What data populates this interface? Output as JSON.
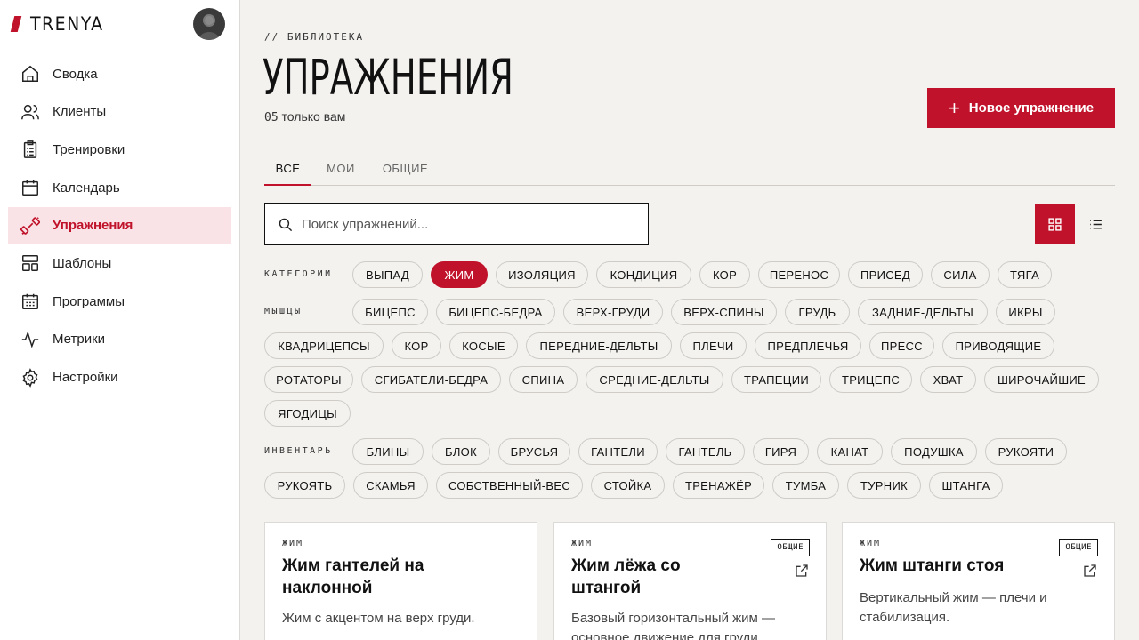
{
  "brand": {
    "name": "TRENYA"
  },
  "sidebar": {
    "items": [
      {
        "label": "Сводка",
        "icon": "home-icon"
      },
      {
        "label": "Клиенты",
        "icon": "users-icon"
      },
      {
        "label": "Тренировки",
        "icon": "clipboard-icon"
      },
      {
        "label": "Календарь",
        "icon": "calendar-icon"
      },
      {
        "label": "Упражнения",
        "icon": "dumbbell-icon",
        "active": true
      },
      {
        "label": "Шаблоны",
        "icon": "layout-icon"
      },
      {
        "label": "Программы",
        "icon": "calendar-grid-icon"
      },
      {
        "label": "Метрики",
        "icon": "activity-icon"
      },
      {
        "label": "Настройки",
        "icon": "gear-icon"
      }
    ]
  },
  "header": {
    "breadcrumb": "// БИБЛИОТЕКА",
    "title": "УПРАЖНЕНИЯ",
    "count": "05",
    "count_suffix": "только вам",
    "new_button": "Новое упражнение"
  },
  "tabs": [
    {
      "label": "ВСЕ",
      "active": true
    },
    {
      "label": "МОИ"
    },
    {
      "label": "ОБЩИЕ"
    }
  ],
  "search": {
    "placeholder": "Поиск упражнений..."
  },
  "filters": {
    "categories_label": "КАТЕГОРИИ",
    "muscles_label": "МЫШЦЫ",
    "equipment_label": "ИНВЕНТАРЬ",
    "categories": [
      "ВЫПАД",
      "ЖИМ",
      "ИЗОЛЯЦИЯ",
      "КОНДИЦИЯ",
      "КОР",
      "ПЕРЕНОС",
      "ПРИСЕД",
      "СИЛА",
      "ТЯГА"
    ],
    "categories_selected": "ЖИМ",
    "muscles": [
      "БИЦЕПС",
      "БИЦЕПС-БЕДРА",
      "ВЕРХ-ГРУДИ",
      "ВЕРХ-СПИНЫ",
      "ГРУДЬ",
      "ЗАДНИЕ-ДЕЛЬТЫ",
      "ИКРЫ",
      "КВАДРИЦЕПСЫ",
      "КОР",
      "КОСЫЕ",
      "ПЕРЕДНИЕ-ДЕЛЬТЫ",
      "ПЛЕЧИ",
      "ПРЕДПЛЕЧЬЯ",
      "ПРЕСС",
      "ПРИВОДЯЩИЕ",
      "РОТАТОРЫ",
      "СГИБАТЕЛИ-БЕДРА",
      "СПИНА",
      "СРЕДНИЕ-ДЕЛЬТЫ",
      "ТРАПЕЦИИ",
      "ТРИЦЕПС",
      "ХВАТ",
      "ШИРОЧАЙШИЕ",
      "ЯГОДИЦЫ"
    ],
    "equipment": [
      "БЛИНЫ",
      "БЛОК",
      "БРУСЬЯ",
      "ГАНТЕЛИ",
      "ГАНТЕЛЬ",
      "ГИРЯ",
      "КАНАТ",
      "ПОДУШКА",
      "РУКОЯТИ",
      "РУКОЯТЬ",
      "СКАМЬЯ",
      "СОБСТВЕННЫЙ-ВЕС",
      "СТОЙКА",
      "ТРЕНАЖЁР",
      "ТУМБА",
      "ТУРНИК",
      "ШТАНГА"
    ]
  },
  "cards": [
    {
      "category": "ЖИМ",
      "title": "Жим гантелей на наклонной",
      "description": "Жим с акцентом на верх груди.",
      "badge": ""
    },
    {
      "category": "ЖИМ",
      "title": "Жим лёжа со штангой",
      "description": "Базовый горизонтальный жим — основное движение для груди.",
      "badge": "ОБЩИЕ"
    },
    {
      "category": "ЖИМ",
      "title": "Жим штанги стоя",
      "description": "Вертикальный жим — плечи и стабилизация.",
      "badge": "ОБЩИЕ"
    }
  ],
  "colors": {
    "accent": "#c0122a",
    "active_bg": "#fae3e6",
    "page_bg": "#f3f2ef"
  }
}
